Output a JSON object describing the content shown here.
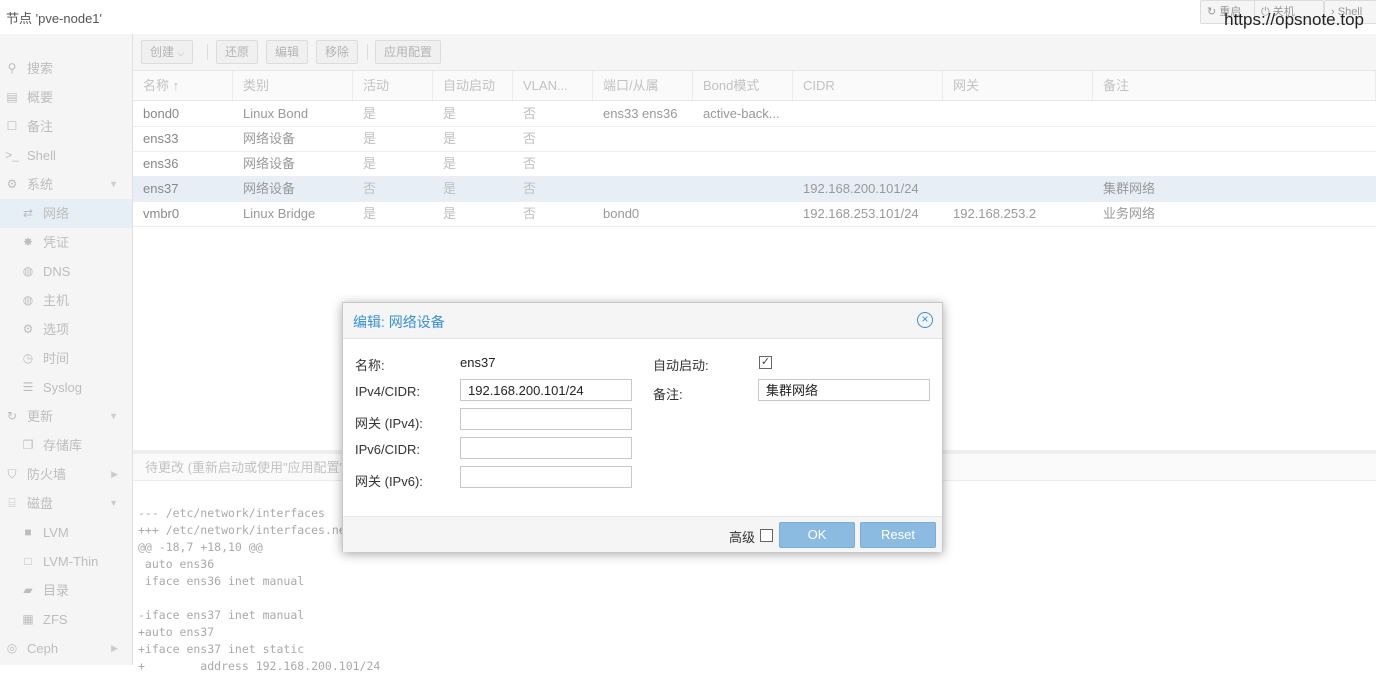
{
  "node_title": "节点 'pve-node1'",
  "top_buttons": {
    "restart": "重启",
    "shutdown": "关机",
    "shell": "Shell"
  },
  "watermark": "https://opsnote.top",
  "sidebar": [
    {
      "label": "搜索",
      "icon": "search-icon",
      "level": 1
    },
    {
      "label": "概要",
      "icon": "book-icon",
      "level": 1
    },
    {
      "label": "备注",
      "icon": "note-icon",
      "level": 1
    },
    {
      "label": "Shell",
      "icon": "terminal-icon",
      "level": 1
    },
    {
      "label": "系统",
      "icon": "cogs-icon",
      "level": 1,
      "expand": true
    },
    {
      "label": "网络",
      "icon": "exchange-icon",
      "level": 2,
      "selected": true
    },
    {
      "label": "凭证",
      "icon": "certificate-icon",
      "level": 2
    },
    {
      "label": "DNS",
      "icon": "globe-icon",
      "level": 2
    },
    {
      "label": "主机",
      "icon": "globe-icon",
      "level": 2
    },
    {
      "label": "选项",
      "icon": "gear-icon",
      "level": 2
    },
    {
      "label": "时间",
      "icon": "clock-icon",
      "level": 2
    },
    {
      "label": "Syslog",
      "icon": "list-icon",
      "level": 2
    },
    {
      "label": "更新",
      "icon": "refresh-icon",
      "level": 1,
      "expand": true
    },
    {
      "label": "存储库",
      "icon": "files-icon",
      "level": 2
    },
    {
      "label": "防火墙",
      "icon": "shield-icon",
      "level": 1,
      "collapsed": true
    },
    {
      "label": "磁盘",
      "icon": "hdd-icon",
      "level": 1,
      "expand": true
    },
    {
      "label": "LVM",
      "icon": "square-icon",
      "level": 2
    },
    {
      "label": "LVM-Thin",
      "icon": "square-outline-icon",
      "level": 2
    },
    {
      "label": "目录",
      "icon": "folder-icon",
      "level": 2
    },
    {
      "label": "ZFS",
      "icon": "th-icon",
      "level": 2
    },
    {
      "label": "Ceph",
      "icon": "ceph-icon",
      "level": 1,
      "collapsed": true
    }
  ],
  "toolbar": {
    "create": "创建",
    "revert": "还原",
    "edit": "编辑",
    "remove": "移除",
    "apply": "应用配置"
  },
  "columns": [
    "名称 ↑",
    "类别",
    "活动",
    "自动启动",
    "VLAN...",
    "端口/从属",
    "Bond模式",
    "CIDR",
    "网关",
    "备注"
  ],
  "rows": [
    [
      "bond0",
      "Linux Bond",
      "是",
      "是",
      "否",
      "ens33 ens36",
      "active-back...",
      "",
      "",
      ""
    ],
    [
      "ens33",
      "网络设备",
      "是",
      "是",
      "否",
      "",
      "",
      "",
      "",
      ""
    ],
    [
      "ens36",
      "网络设备",
      "是",
      "是",
      "否",
      "",
      "",
      "",
      "",
      ""
    ],
    [
      "ens37",
      "网络设备",
      "否",
      "是",
      "否",
      "",
      "",
      "192.168.200.101/24",
      "",
      "集群网络"
    ],
    [
      "vmbr0",
      "Linux Bridge",
      "是",
      "是",
      "否",
      "bond0",
      "",
      "192.168.253.101/24",
      "192.168.253.2",
      "业务网络"
    ]
  ],
  "pending": {
    "title": "待更改 (重新启动或使用\"应用配置\"激活)",
    "diff": "--- /etc/network/interfaces\n+++ /etc/network/interfaces.new\n@@ -18,7 +18,10 @@\n auto ens36\n iface ens36 inet manual\n\n-iface ens37 inet manual\n+auto ens37\n+iface ens37 inet static\n+        address 192.168.200.101/24"
  },
  "dialog": {
    "title": "编辑: 网络设备",
    "name_label": "名称:",
    "name_value": "ens37",
    "ipv4_label": "IPv4/CIDR:",
    "ipv4_value": "192.168.200.101/24",
    "gw4_label": "网关 (IPv4):",
    "gw4_value": "",
    "ipv6_label": "IPv6/CIDR:",
    "ipv6_value": "",
    "gw6_label": "网关 (IPv6):",
    "gw6_value": "",
    "autostart_label": "自动启动:",
    "autostart_checked": true,
    "comment_label": "备注:",
    "comment_value": "集群网络",
    "advanced_label": "高级",
    "advanced_checked": false,
    "ok_label": "OK",
    "reset_label": "Reset"
  }
}
